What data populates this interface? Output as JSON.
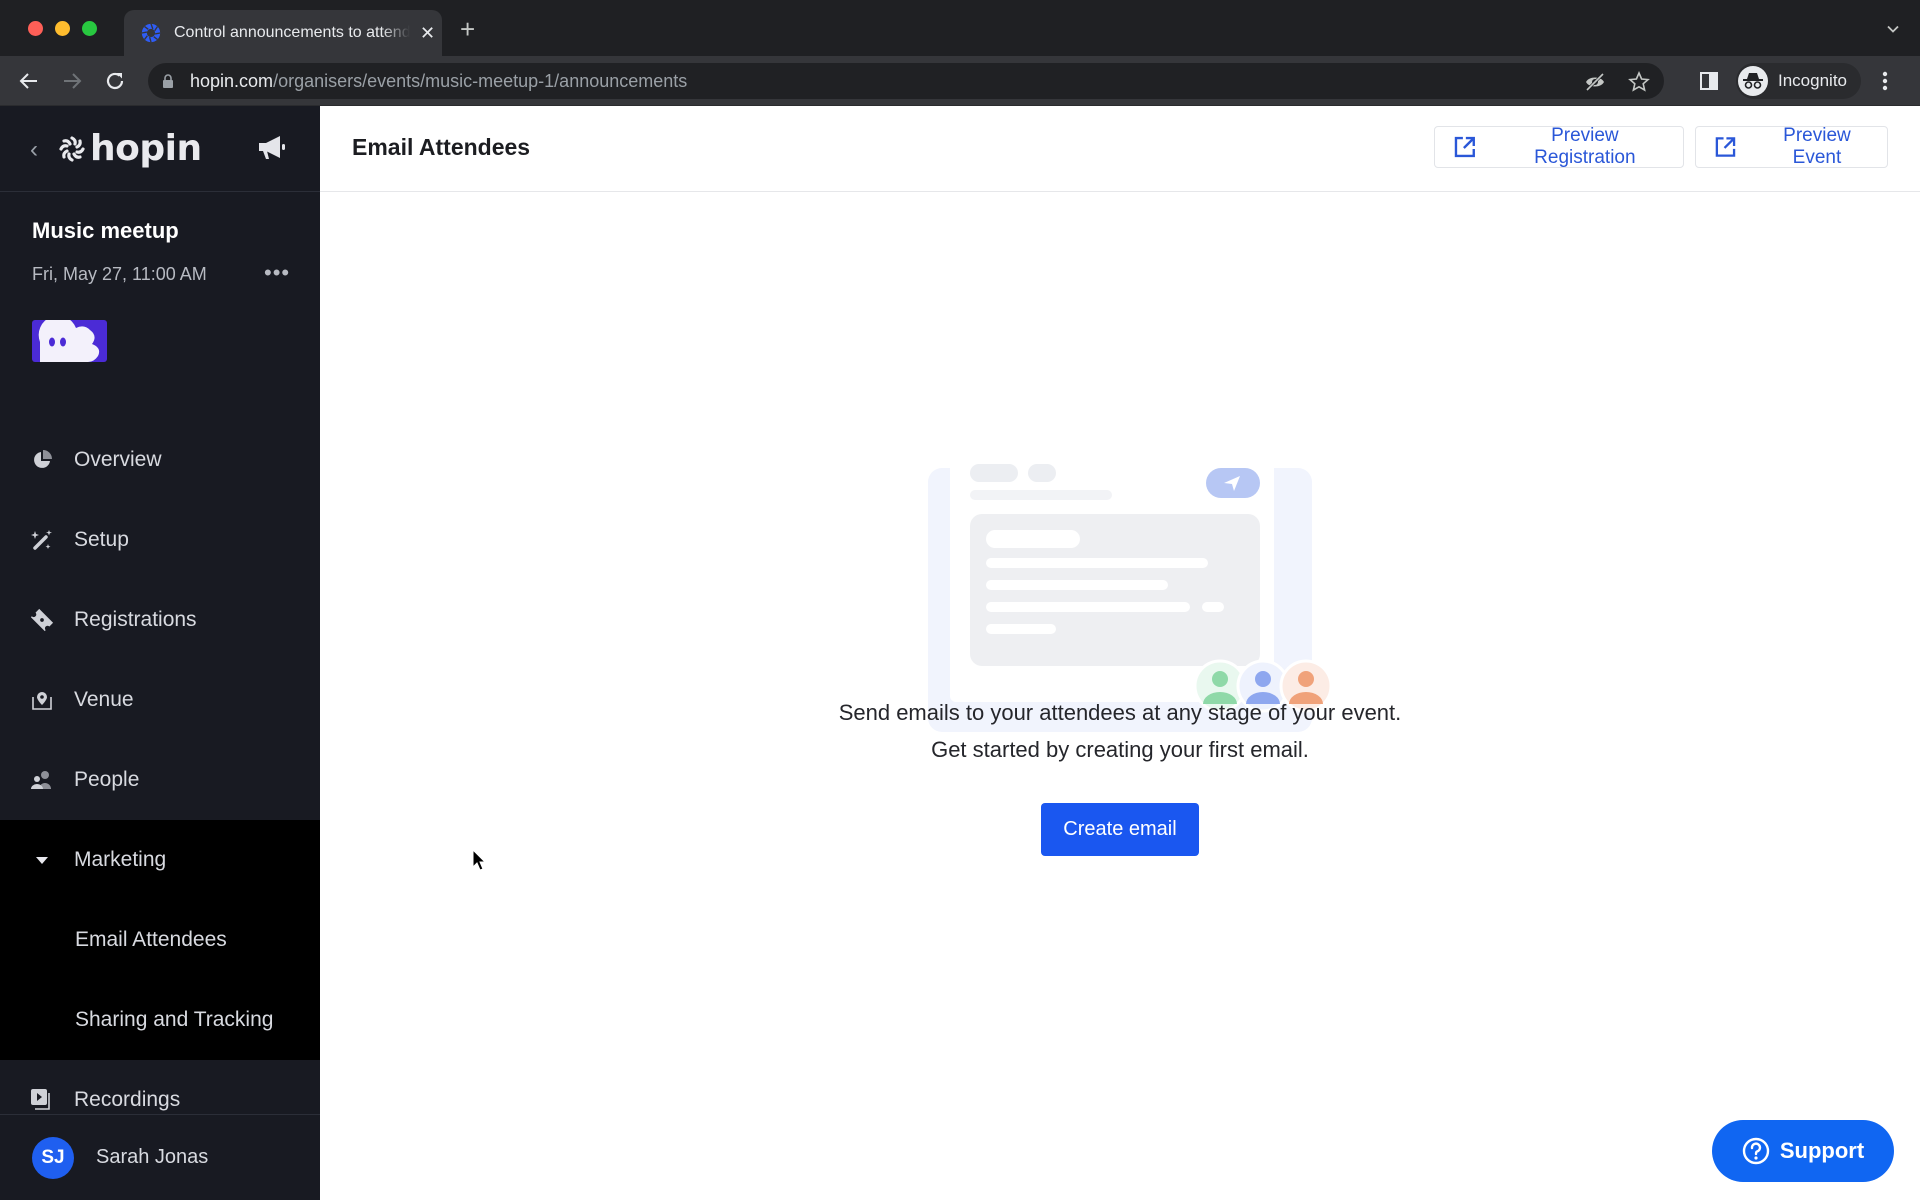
{
  "browser": {
    "tab_title": "Control announcements to attendees",
    "new_tab_label": "+",
    "url_host": "hopin.com",
    "url_path": "/organisers/events/music-meetup-1/announcements",
    "profile_label": "Incognito"
  },
  "sidebar": {
    "logo_text": "hopin",
    "event": {
      "name": "Music meetup",
      "date": "Fri, May 27, 11:00 AM",
      "more_label": "•••"
    },
    "nav": [
      {
        "label": "Overview",
        "icon": "pie-chart-icon"
      },
      {
        "label": "Setup",
        "icon": "magic-wand-icon"
      },
      {
        "label": "Registrations",
        "icon": "ticket-icon"
      },
      {
        "label": "Venue",
        "icon": "venue-pin-icon"
      },
      {
        "label": "People",
        "icon": "people-icon"
      }
    ],
    "marketing": {
      "label": "Marketing",
      "expanded": true,
      "children": [
        {
          "label": "Email Attendees",
          "active": true
        },
        {
          "label": "Sharing and Tracking"
        }
      ]
    },
    "recordings": {
      "label": "Recordings",
      "icon": "recordings-icon"
    },
    "user": {
      "initials": "SJ",
      "name": "Sarah Jonas"
    }
  },
  "main": {
    "title": "Email Attendees",
    "preview_registration_label": "Preview Registration",
    "preview_event_label": "Preview Event",
    "empty_state": {
      "line1": "Send emails to your attendees at any stage of your event.",
      "line2": "Get started by creating your first email.",
      "cta_label": "Create email"
    },
    "support_label": "Support"
  },
  "colors": {
    "primary": "#1a57f0",
    "link": "#2a57d8",
    "sidebar_bg": "#181a22",
    "sidebar_group_bg": "#000000",
    "avatar_green": "#8fd9a8",
    "avatar_blue": "#8ea7ef",
    "avatar_orange": "#f0a27a"
  }
}
